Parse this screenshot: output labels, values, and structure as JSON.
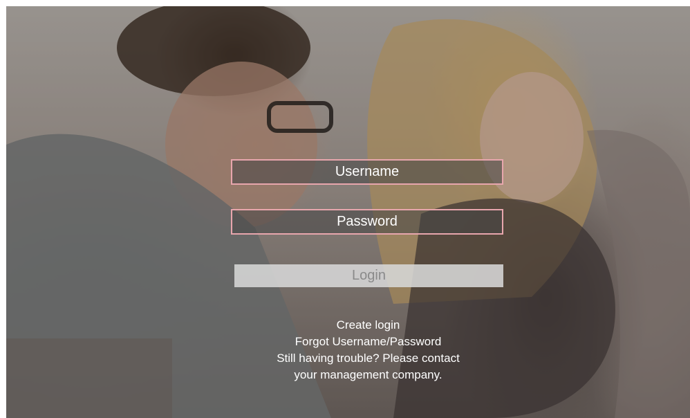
{
  "background": {
    "image": "couple-on-couch-photo"
  },
  "login_form": {
    "username_placeholder": "Username",
    "password_placeholder": "Password",
    "login_label": "Login",
    "field_border_color": "#e8a6ad"
  },
  "links": {
    "create_login": "Create login",
    "forgot": "Forgot Username/Password",
    "support_line1": "Still having trouble? Please contact",
    "support_line2": "your management company."
  }
}
